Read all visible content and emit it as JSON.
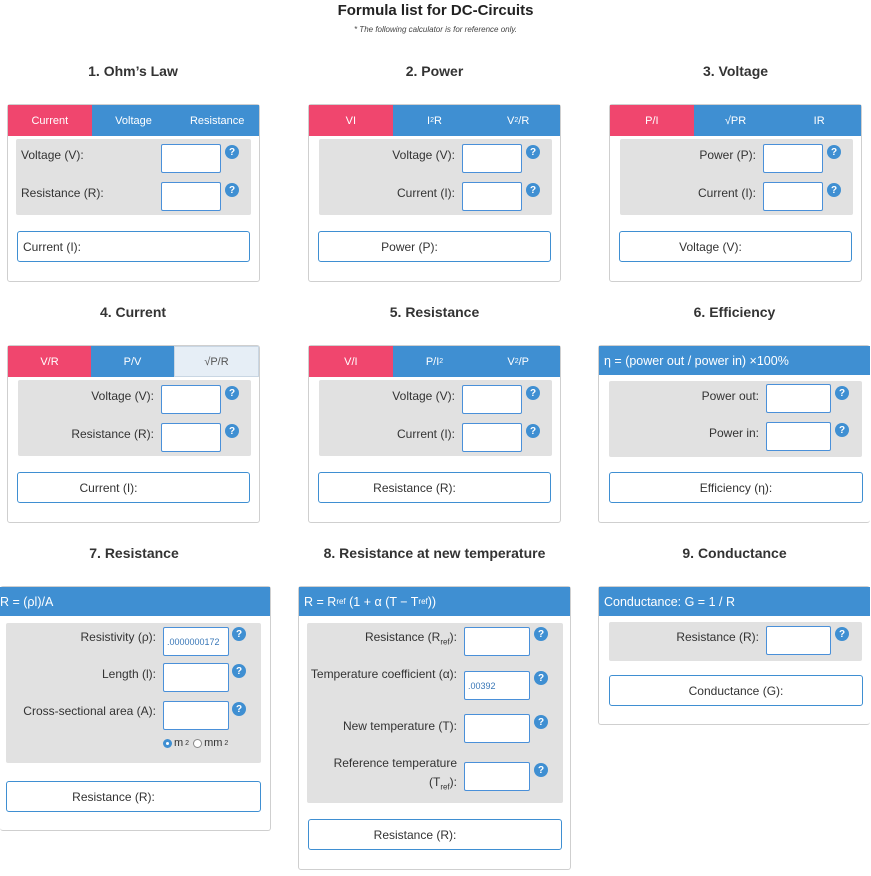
{
  "header": {
    "title": "Formula list for DC-Circuits",
    "subtitle": "* The following calculator is for reference only."
  },
  "help_icon": "?",
  "s1": {
    "title": "1. Ohm’s Law",
    "tabs": [
      "Current",
      "Voltage",
      "Resistance"
    ],
    "voltage_label": "Voltage (V):",
    "resistance_label": "Resistance (R):",
    "result": "Current (I):"
  },
  "s2": {
    "title": "2. Power",
    "tab1": "VI",
    "tab2_base": "I",
    "tab2_sup": "2",
    "tab2_end": "R",
    "tab3_base": "V",
    "tab3_sup": "2",
    "tab3_end": "/R",
    "voltage_label": "Voltage (V):",
    "current_label": "Current (I):",
    "result": "Power (P):"
  },
  "s3": {
    "title": "3. Voltage",
    "tab1": "P/I",
    "tab2": "√PR",
    "tab3": "IR",
    "power_label": "Power (P):",
    "current_label": "Current (I):",
    "result": "Voltage (V):"
  },
  "s4": {
    "title": "4. Current",
    "tab1": "V/R",
    "tab2": "P/V",
    "tab3": "√P/R",
    "voltage_label": "Voltage (V):",
    "resistance_label": "Resistance (R):",
    "result": "Current (I):"
  },
  "s5": {
    "title": "5. Resistance",
    "tab1": "V/I",
    "tab2_base": "P/I",
    "tab2_sup": "2",
    "tab3_base": "V",
    "tab3_sup": "2",
    "tab3_end": "/P",
    "voltage_label": "Voltage (V):",
    "current_label": "Current (I):",
    "result": "Resistance (R):"
  },
  "s6": {
    "title": "6. Efficiency",
    "formula": "η = (power out / power in) ×100%",
    "power_out_label": "Power out:",
    "power_in_label": "Power in:",
    "result": "Efficiency (η):"
  },
  "s7": {
    "title": "7. Resistance",
    "formula": "R = (ρl)/A",
    "resistivity_label": "Resistivity (ρ):",
    "resistivity_value": ".0000000172",
    "length_label": "Length (l):",
    "area_label": "Cross-sectional area (A):",
    "unit_m2": "m",
    "unit_mm2": "mm",
    "unit_sup": "2",
    "result": "Resistance (R):"
  },
  "s8": {
    "title": "8. Resistance at new temperature",
    "formula_a": "R = R",
    "formula_ref1": "ref",
    "formula_b": " (1 + α (T − T",
    "formula_ref2": "ref",
    "formula_c": "))",
    "resistance_label": "Resistance (R",
    "ref_sub": "ref",
    "label_end": "):",
    "temp_coef_label": "Temperature coefficient (α):",
    "temp_coef_value": ".00392",
    "new_temp_label": "New temperature (T):",
    "ref_temp_label": "Reference temperature (T",
    "result": "Resistance (R):"
  },
  "s9": {
    "title": "9. Conductance",
    "formula": "Conductance: G = 1 / R",
    "resistance_label": "Resistance (R):",
    "result": "Conductance (G):"
  }
}
